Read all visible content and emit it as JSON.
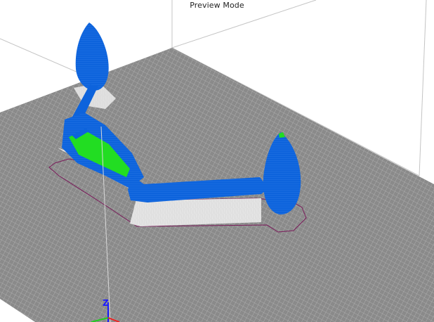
{
  "viewer": {
    "mode_label": "Preview Mode",
    "axis_z_label": "Z"
  },
  "colors": {
    "background": "#ffffff",
    "build_plate": "#8a8a8a",
    "grid_lines": "#b8b8b8",
    "build_volume_edges": "#c4c4c4",
    "model_shell": "#0d63dc",
    "model_shell_highlight": "#3a86f0",
    "infill": "#22dd22",
    "support_material": "#e6e6e6",
    "skirt_outline": "#7a1a5a",
    "axis_z": "#1a1aff",
    "axis_x": "#22cc22"
  },
  "icons": {
    "axis_gizmo": "xyz-axis-icon"
  }
}
